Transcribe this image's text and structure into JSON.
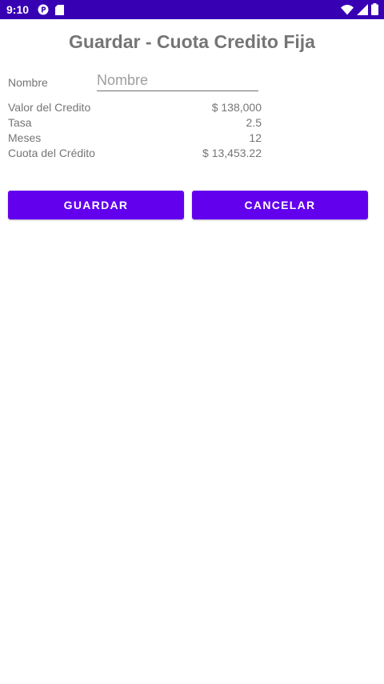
{
  "status_bar": {
    "time": "9:10",
    "background_color": "#3700b3",
    "left_icons": [
      "app-notification-icon",
      "sd-card-icon"
    ],
    "right_icons": [
      "wifi-icon",
      "cellular-signal-icon",
      "battery-icon"
    ]
  },
  "page": {
    "title": "Guardar - Cuota Credito Fija"
  },
  "form": {
    "name_label": "Nombre",
    "name_placeholder": "Nombre",
    "name_value": ""
  },
  "details": {
    "loan_value_label": "Valor del Credito",
    "loan_value": "$ 138,000",
    "rate_label": "Tasa",
    "rate_value": "2.5",
    "months_label": "Meses",
    "months_value": "12",
    "installment_label": "Cuota del Crédito",
    "installment_value": "$ 13,453.22"
  },
  "actions": {
    "save_label": "GUARDAR",
    "cancel_label": "CANCELAR",
    "button_color": "#6200ee"
  }
}
